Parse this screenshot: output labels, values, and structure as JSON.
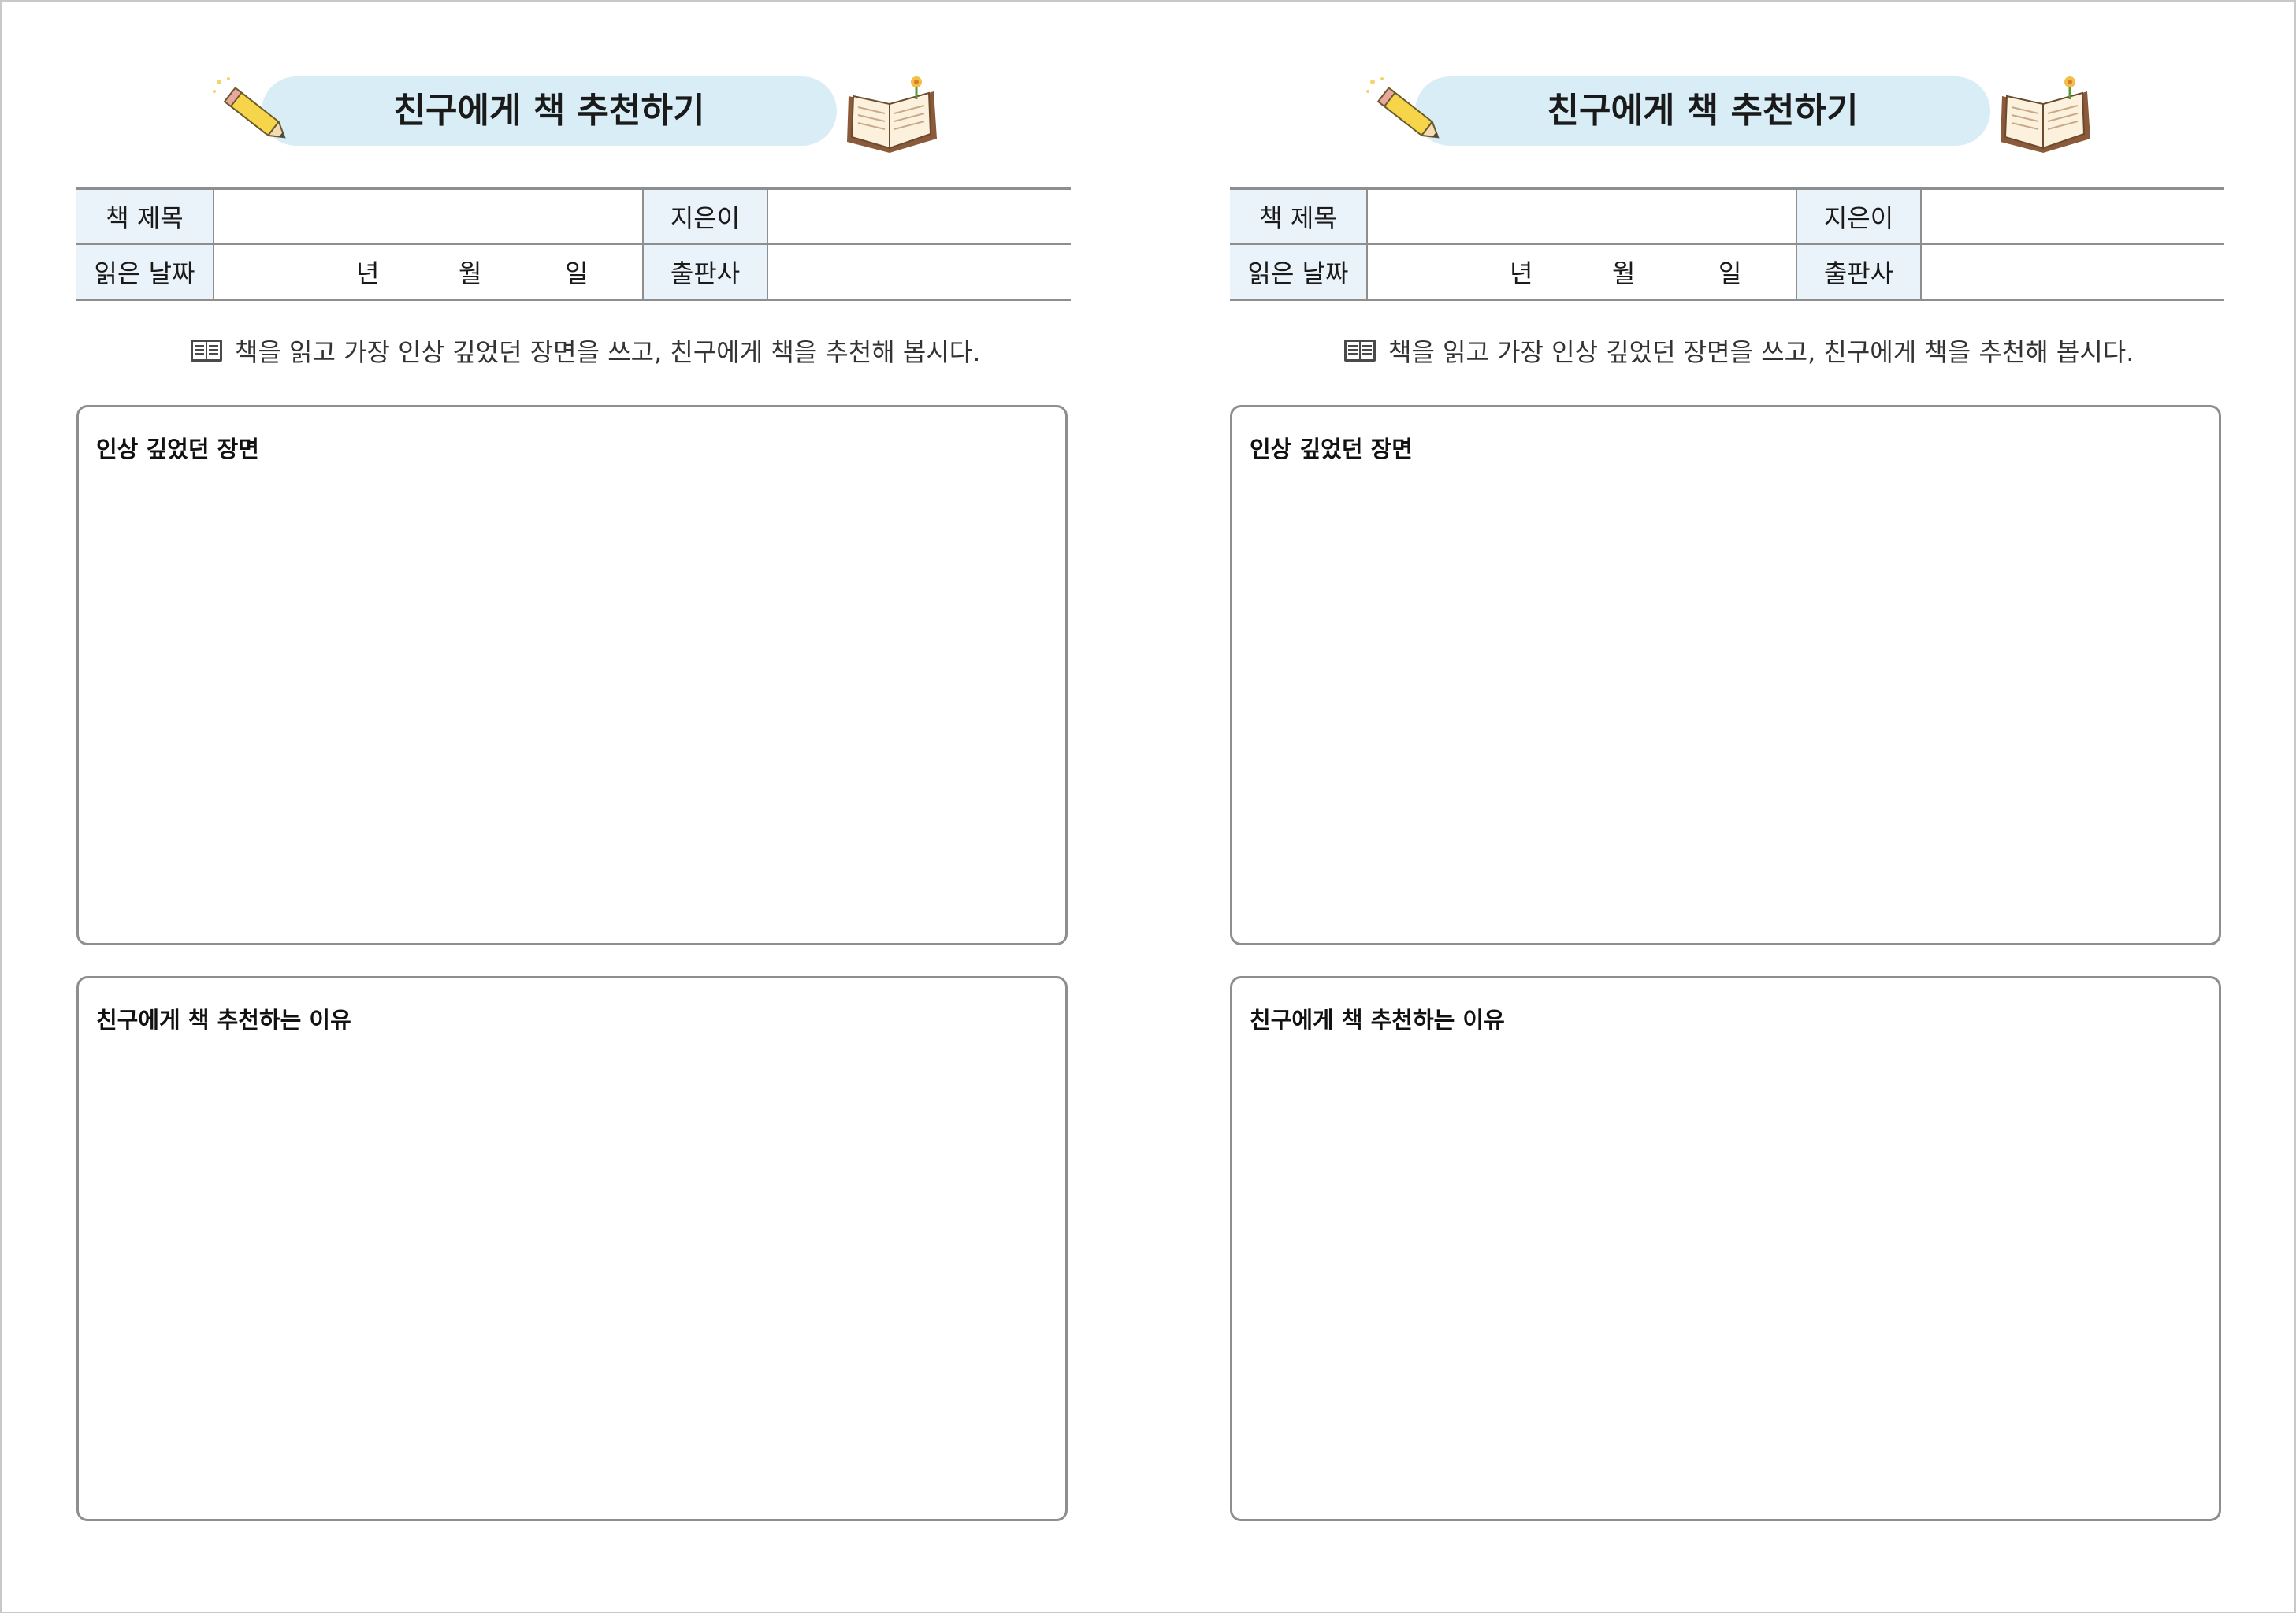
{
  "pages": [
    {
      "title": "친구에게 책 추천하기",
      "table": {
        "book_title_label": "책 제목",
        "author_label": "지은이",
        "read_date_label": "읽은 날짜",
        "publisher_label": "출판사",
        "date_units": [
          "년",
          "월",
          "일"
        ]
      },
      "instruction": "책을 읽고 가장 인상 깊었던 장면을 쓰고, 친구에게 책을 추천해 봅시다.",
      "boxes": [
        "인상 깊었던 장면",
        "친구에게 책 추천하는 이유"
      ]
    },
    {
      "title": "친구에게 책 추천하기",
      "table": {
        "book_title_label": "책 제목",
        "author_label": "지은이",
        "read_date_label": "읽은 날짜",
        "publisher_label": "출판사",
        "date_units": [
          "년",
          "월",
          "일"
        ]
      },
      "instruction": "책을 읽고 가장 인상 깊었던 장면을 쓰고, 친구에게 책을 추천해 봅시다.",
      "boxes": [
        "인상 깊었던 장면",
        "친구에게 책 추천하는 이유"
      ]
    }
  ],
  "colors": {
    "banner": "#d9edf6",
    "label_cell": "#eaf3f9",
    "border": "#8e8e8e"
  },
  "icons": [
    "pencil-icon",
    "open-book-icon",
    "book-icon"
  ]
}
